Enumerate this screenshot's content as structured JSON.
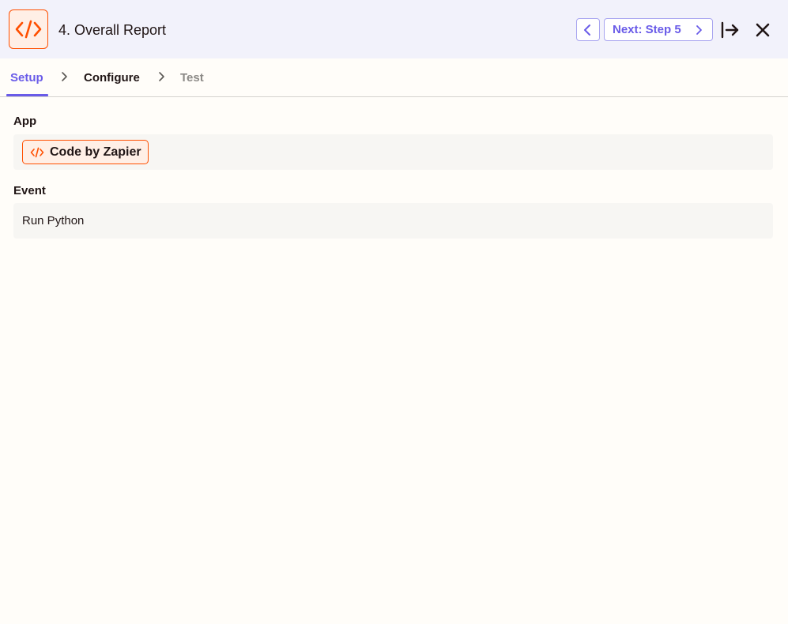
{
  "header": {
    "step_title": "4. Overall Report",
    "next_label": "Next: Step 5",
    "icons": {
      "app": "code-icon",
      "prev": "chevron-left-icon",
      "next": "chevron-right-icon",
      "pin": "arrow-right-to-bar-icon",
      "close": "close-icon"
    }
  },
  "tabs": [
    {
      "label": "Setup",
      "state": "active"
    },
    {
      "label": "Configure",
      "state": "enabled"
    },
    {
      "label": "Test",
      "state": "disabled"
    }
  ],
  "fields": {
    "app": {
      "label": "App",
      "value": "Code by Zapier",
      "icon": "code-icon"
    },
    "event": {
      "label": "Event",
      "value": "Run Python"
    }
  },
  "colors": {
    "accent": "#695be8",
    "brand": "#ff4f00",
    "header_bg": "#f2f2fb",
    "page_bg": "#fffdf9",
    "field_bg": "#f7f6f3"
  }
}
